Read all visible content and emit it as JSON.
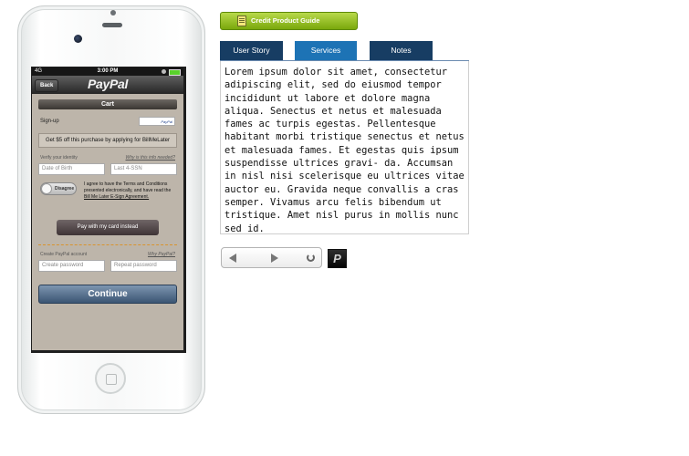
{
  "phone": {
    "status": {
      "signal": "4G",
      "time": "3:00 PM"
    },
    "nav": {
      "back_label": "Back",
      "logo": "PayPal"
    },
    "cart_label": "Cart",
    "signup_label": "Sign-up",
    "bml_logo_text": "PayPal",
    "offer_text": "Get $5 off this purchase by applying for BillMeLater",
    "verify_label": "Verify your identity",
    "why_needed_link": "Why is this info needed?",
    "dob_placeholder": "Date of Birth",
    "ssn_placeholder": "Last 4-SSN",
    "toggle_label": "Disagree",
    "agree_text": "I agree to have the Terms and Conditions presented electronically, and have read the",
    "agree_link": "Bill Me Later E-Sign Agreement.",
    "card_button": "Pay with my card instead",
    "create_account_label": "Create PayPal account",
    "why_paypal_link": "Why PayPal?",
    "create_password_placeholder": "Create password",
    "repeat_password_placeholder": "Repeat password",
    "continue_button": "Continue"
  },
  "guide_button": "Credit Product Guide",
  "tabs": [
    {
      "label": "User Story",
      "active": false
    },
    {
      "label": "Services",
      "active": true
    },
    {
      "label": "Notes",
      "active": false
    }
  ],
  "content_text": "Lorem ipsum dolor sit amet, consectetur adipiscing elit, sed do eiusmod tempor incididunt ut labore et dolore magna aliqua. Senectus et netus et malesuada fames ac turpis egestas. Pellentesque habitant morbi tristique senectus et netus et malesuada fames. Et egestas quis ipsum suspendisse ultrices gravi- da. Accumsan in nisl nisi scelerisque eu ultrices vitae auctor eu. Gravida neque convallis a cras semper. Vivamus arcu felis bibendum ut tristique. Amet nisl purus in mollis nunc sed id.",
  "player": {
    "logo_letter": "P"
  },
  "colors": {
    "tab_active": "#1d73b5",
    "tab_inactive": "#173d63",
    "guide_green": "#7aa80c"
  }
}
